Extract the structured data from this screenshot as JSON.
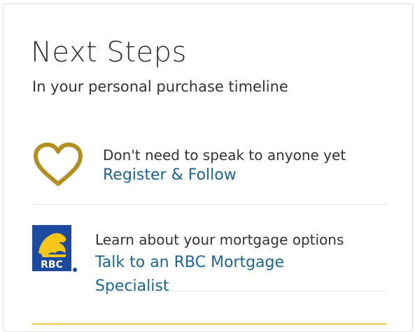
{
  "panel": {
    "title": "Next Steps",
    "subtitle": "In your personal purchase timeline"
  },
  "steps": [
    {
      "icon": "heart-icon",
      "text": "Don't need to speak to anyone yet",
      "link_label": "Register & Follow"
    },
    {
      "icon": "rbc-logo",
      "logo_text": "RBC",
      "text": "Learn about your mortgage options",
      "link_line1": "Talk to an RBC Mortgage",
      "link_line2": "Specialist"
    }
  ],
  "colors": {
    "heart": "#b38f1f",
    "link": "#1a6496",
    "rbc_blue": "#1b4aa0",
    "rbc_gold": "#f5c518"
  }
}
